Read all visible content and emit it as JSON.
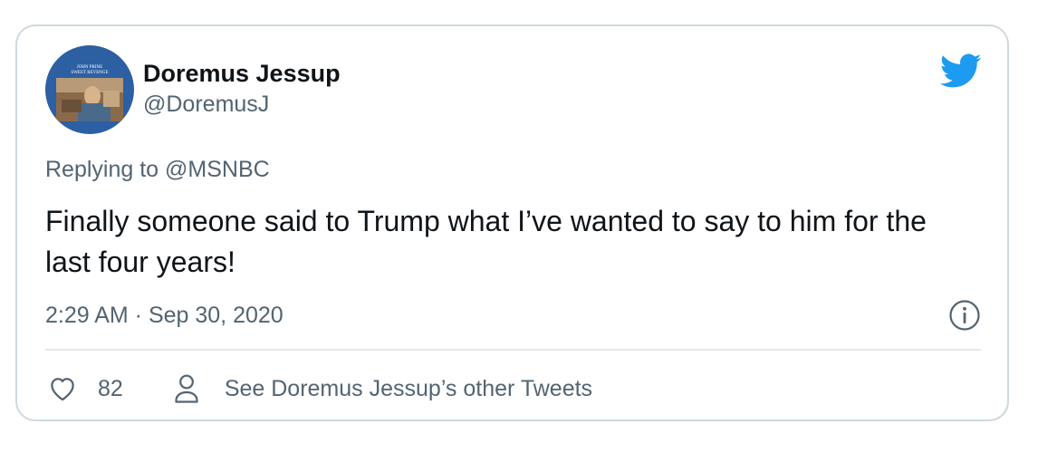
{
  "author": {
    "display_name": "Doremus Jessup",
    "handle": "@DoremusJ"
  },
  "avatar": {
    "album_text_line1": "JOHN PRINE",
    "album_text_line2": "SWEET REVENGE"
  },
  "reply": {
    "prefix": "Replying to ",
    "mention": "@MSNBC"
  },
  "tweet": {
    "text": "Finally someone said to Trump what I’ve wanted to say to him for the last four years!"
  },
  "meta": {
    "timestamp": "2:29 AM · Sep 30, 2020"
  },
  "actions": {
    "like_count": "82",
    "profile_link": "See Doremus Jessup’s other Tweets"
  },
  "icons": {
    "brand": "twitter-bird-icon",
    "info": "info-icon",
    "like": "heart-icon",
    "profile": "person-icon"
  },
  "colors": {
    "brand_blue": "#1d9bf0",
    "text_primary": "#0f1419",
    "text_secondary": "#536471",
    "border": "#cfd9de"
  }
}
